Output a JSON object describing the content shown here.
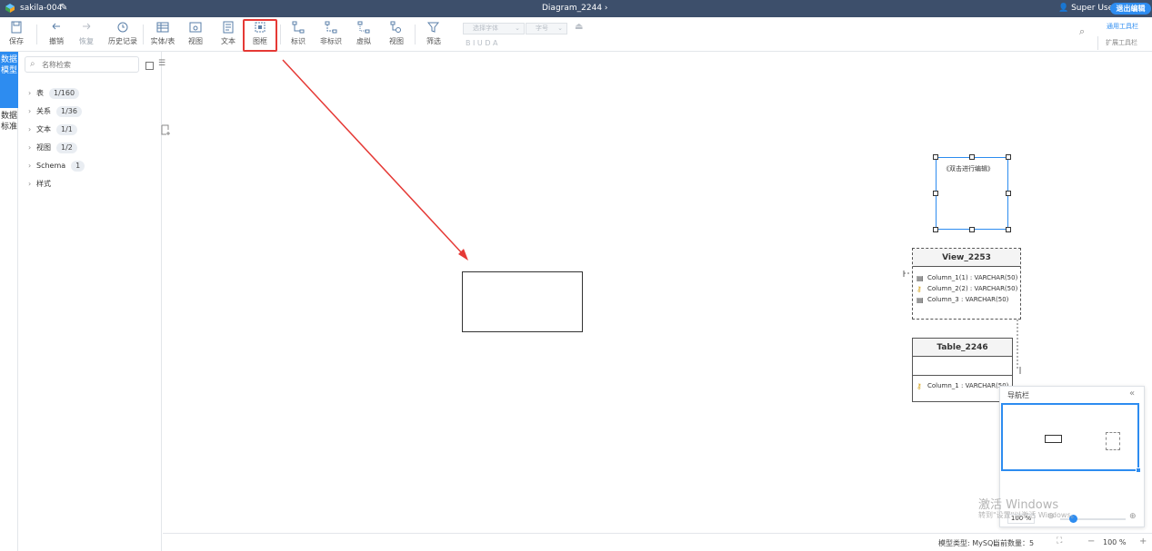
{
  "titlebar": {
    "project": "sakila-004",
    "diagram": "Diagram_2244 ›",
    "user": "Super User",
    "exit_button": "退出编辑"
  },
  "toolbar": {
    "save": "保存",
    "undo": "撤销",
    "redo": "恢复",
    "history": "历史记录",
    "entity": "实体/表",
    "view": "视图",
    "text": "文本",
    "frame": "图框",
    "identifying": "标识",
    "non_identifying": "非标识",
    "virtual": "虚拟",
    "view_rel": "视图",
    "filter": "筛选",
    "font_select": "选择字体",
    "size_select": "字号",
    "format": "B  I  U  D  A",
    "common_toolbar": "通用工具栏",
    "ext_toolbar": "扩展工具栏"
  },
  "left_tabs": {
    "data_model": "数据模型",
    "data_standard": "数据标准"
  },
  "tree": {
    "search_placeholder": "名称检索",
    "items": [
      {
        "label": "表",
        "count": "1/160"
      },
      {
        "label": "关系",
        "count": "1/36"
      },
      {
        "label": "文本",
        "count": "1/1"
      },
      {
        "label": "视图",
        "count": "1/2"
      },
      {
        "label": "Schema",
        "count": "1"
      },
      {
        "label": "样式",
        "count": ""
      }
    ]
  },
  "canvas": {
    "note_text": "《双击进行编辑》",
    "view_entity": {
      "name": "View_2253",
      "columns": [
        "Column_1(1) : VARCHAR(50)",
        "Column_2(2) : VARCHAR(50)",
        "Column_3 : VARCHAR(50)"
      ]
    },
    "table_entity": {
      "name": "Table_2246",
      "columns": [
        "Column_1 : VARCHAR(50)"
      ]
    }
  },
  "navigator": {
    "title": "导航栏",
    "zoom": "100 %"
  },
  "watermark": {
    "line1": "激活 Windows",
    "line2": "转到\"设置\"以激活 Windows。"
  },
  "status": {
    "model_type": "模型类型: MySQL",
    "count": "当前数量：5",
    "zoom": "100 %"
  },
  "colors": {
    "titlebar": "#3d4f6b",
    "accent": "#2d8cf0",
    "highlight": "#e53935"
  }
}
